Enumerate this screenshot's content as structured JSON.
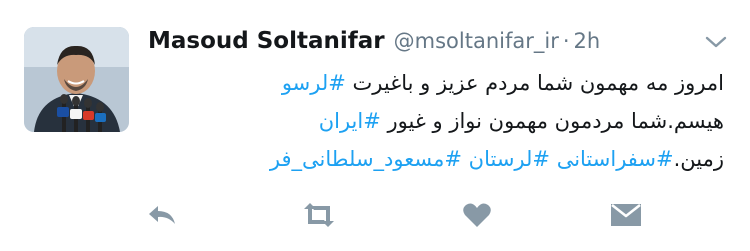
{
  "user": {
    "name": "Masoud Soltanifar",
    "handle": "@msoltanifar_ir",
    "separator": "·",
    "time": "2h"
  },
  "tweet": {
    "line1": {
      "text": "امروز مه مهمون شما مردم عزیز و باغیرت ",
      "tag": "#لرسو"
    },
    "line2": {
      "text": "هیسم.شما مردمون مهمون نواز و غیور ",
      "tag": "#ایران"
    },
    "line3": {
      "text": "زمین.",
      "tag1": "#سفراستانی",
      "tag2": "#لرستان",
      "tag3": "#مسعود_سلطانی_فر"
    }
  },
  "icons": {
    "reply": "reply-icon",
    "retweet": "retweet-icon",
    "like": "heart-icon",
    "message": "envelope-icon",
    "more": "chevron-down-icon"
  },
  "colors": {
    "hashtag": "#1da1f2",
    "icon_gray": "#8899a6",
    "text": "#14171a",
    "muted": "#657786"
  }
}
